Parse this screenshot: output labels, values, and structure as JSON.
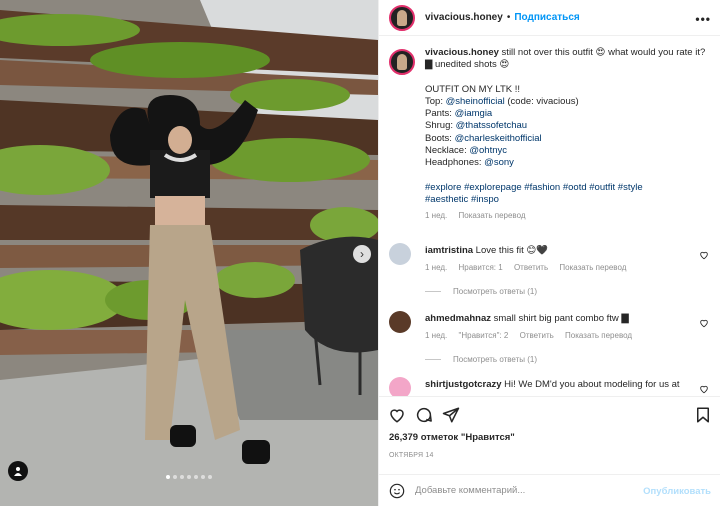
{
  "post": {
    "author": "vivacious.honey",
    "separator": "•",
    "follow_label": "Подписаться",
    "more_label": "•••"
  },
  "caption": {
    "username": "vivacious.honey",
    "first_text": " still not over this outfit 😍 what would you rate it? ▇ unedited shots 😍",
    "outfit_heading": "OUTFIT ON MY LTK !!",
    "items": [
      {
        "label": "Top: ",
        "tag": "@sheinofficial",
        "suffix": " (code: vivacious)"
      },
      {
        "label": "Pants: ",
        "tag": "@iamgia",
        "suffix": ""
      },
      {
        "label": "Shrug: ",
        "tag": "@thatssofetchau",
        "suffix": ""
      },
      {
        "label": "Boots: ",
        "tag": "@charleskeithofficial",
        "suffix": ""
      },
      {
        "label": "Necklace: ",
        "tag": "@ohtnyc",
        "suffix": ""
      },
      {
        "label": "Headphones: ",
        "tag": "@sony",
        "suffix": ""
      }
    ],
    "hashtags_line1": "#explore #explorepage #fashion #ootd #outfit #style",
    "hashtags_line2": "#aesthetic #inspo",
    "age": "1 нед.",
    "translate": "Показать перевод"
  },
  "comments": [
    {
      "username": "iamtristina",
      "text": " Love this fit 😊🖤",
      "age": "1 нед.",
      "likes": "Нравится: 1",
      "reply": "Ответить",
      "translate": "Показать перевод",
      "view_replies": "Посмотреть ответы (1)"
    },
    {
      "username": "ahmedmahnaz",
      "text": " small shirt big pant combo ftw ▇",
      "age": "1 нед.",
      "likes": "\"Нравится\": 2",
      "reply": "Ответить",
      "translate": "Показать перевод",
      "view_replies": "Посмотреть ответы (1)"
    },
    {
      "username": "shirtjustgotcrazy",
      "text": " Hi! We DM'd you about modeling for us at"
    }
  ],
  "stats": {
    "likes": "26,379 отметок \"Нравится\"",
    "date": "ОКТЯБРЯ 14"
  },
  "add_comment": {
    "placeholder": "Добавьте комментарий...",
    "publish": "Опубликовать"
  },
  "carousel": {
    "slides": 7,
    "active_index": 0
  },
  "colors": {
    "accent": "#0095f6",
    "link": "#00376b",
    "muted": "#8e8e8e",
    "story_ring": "#e1306c",
    "publish_disabled": "#b2dffc"
  }
}
